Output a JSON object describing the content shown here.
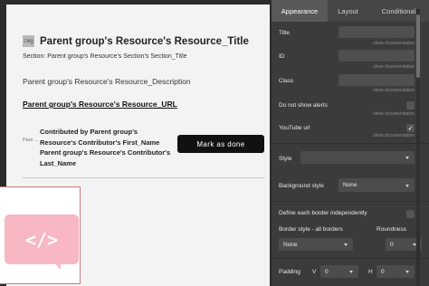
{
  "canvas": {
    "resource_title": "Parent group's Resource's Resource_Title",
    "image_placeholder": "img",
    "section_line": "Section: Parent group's Resource's Section's Section_Title",
    "description": "Parent group's Resource's Resource_Description",
    "url_text": "Parent group's Resource's Resource_URL",
    "avatar_placeholder": "Pare ...",
    "contributor_text": "Contributed by Parent group's Resource's Contributor's First_Name Parent group's Resource's Contributor's Last_Name",
    "mark_button": "Mark as done",
    "code_icon": "</>"
  },
  "panel": {
    "tabs": [
      {
        "label": "Appearance",
        "active": true
      },
      {
        "label": "Layout",
        "active": false
      },
      {
        "label": "Conditional",
        "active": false
      }
    ],
    "fields": {
      "title_label": "Title",
      "id_label": "ID",
      "class_label": "Class",
      "do_not_show_alerts_label": "Do not show alerts",
      "youtube_label": "YouTube url",
      "show_documentation": "show documentation"
    },
    "youtube_checked": true,
    "style_label": "Style",
    "style_value": "",
    "background_style_label": "Background style",
    "background_style_value": "None",
    "define_border_label": "Define each border independently",
    "border_style_label": "Border style - all borders",
    "border_style_value": "None",
    "roundness_label": "Roundness",
    "roundness_value": "0",
    "padding_label": "Padding",
    "padding_v_label": "V",
    "padding_v_value": "0",
    "padding_h_label": "H",
    "padding_h_value": "0"
  },
  "colors": {
    "panel_bg": "#3b3b3b",
    "page_bg": "#f4f3f3",
    "button_bg": "#111111",
    "code_bubble": "#f7b7c3"
  }
}
